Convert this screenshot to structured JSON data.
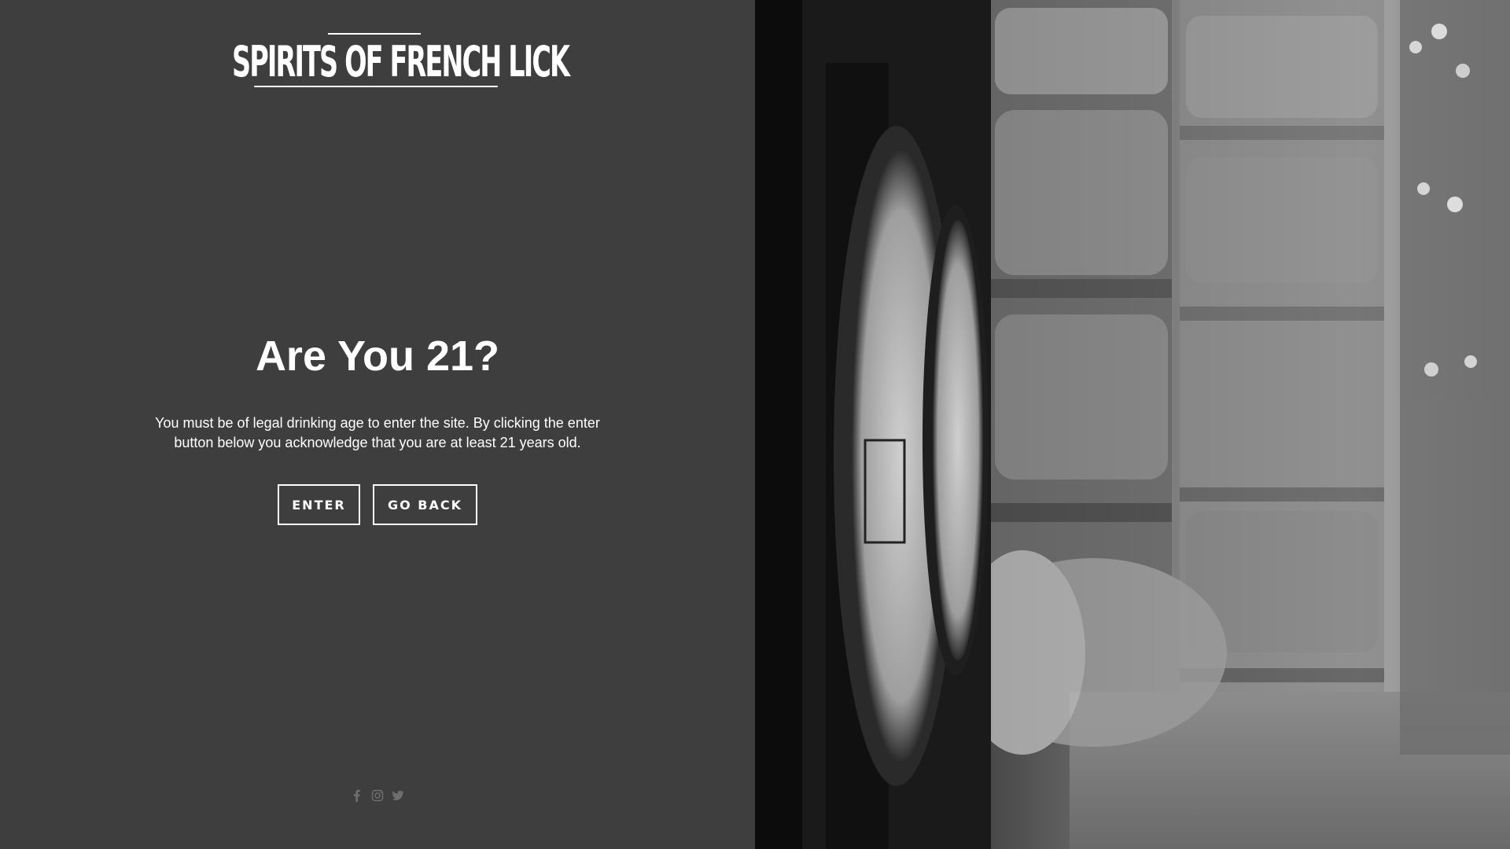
{
  "brand": {
    "logo_text": "SPIRITS OF FRENCH LICK"
  },
  "age_gate": {
    "title": "Are You 21?",
    "description": "You must be of legal drinking age to enter the site. By clicking the enter button below you acknowledge that you are at least 21 years old.",
    "enter_label": "ENTER",
    "go_back_label": "GO BACK"
  },
  "social": [
    {
      "icon": "facebook-icon"
    },
    {
      "icon": "instagram-icon"
    },
    {
      "icon": "twitter-icon"
    }
  ],
  "hero_image": {
    "icon": "barrel-warehouse-photo"
  },
  "colors": {
    "background": "#3e3e3f",
    "text": "#ffffff",
    "social_icon": "#6e6e6e"
  }
}
